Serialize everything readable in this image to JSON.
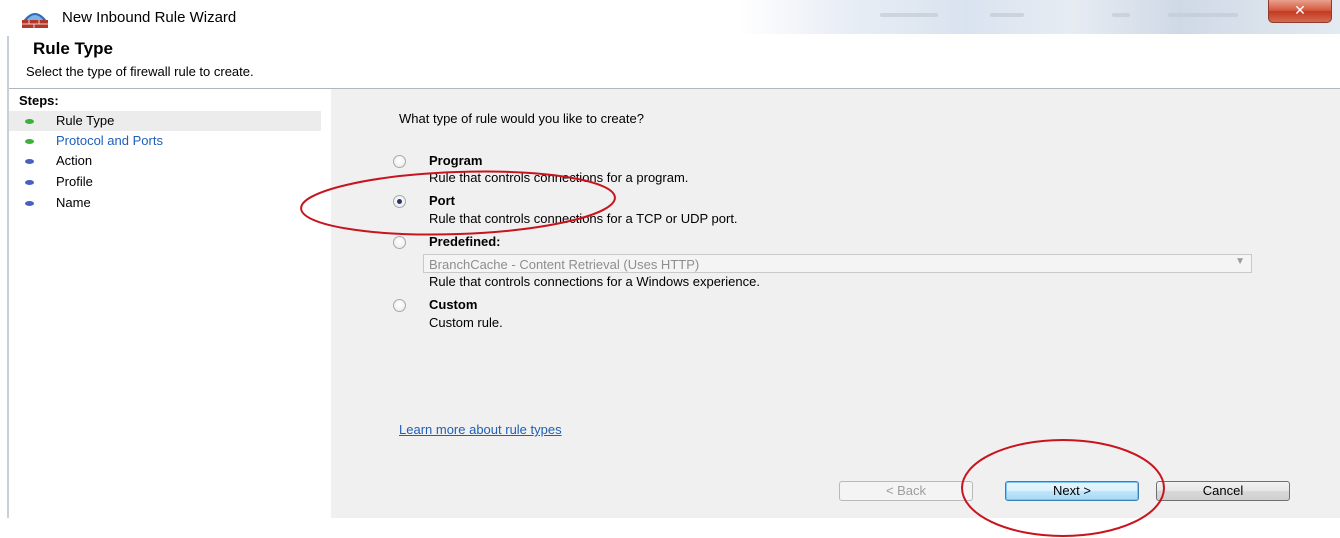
{
  "window": {
    "title": "New Inbound Rule Wizard",
    "close_glyph": "✕",
    "icon": "firewall-wizard-icon"
  },
  "header": {
    "title": "Rule Type",
    "subtitle": "Select the type of firewall rule to create."
  },
  "steps": {
    "heading": "Steps:",
    "items": [
      {
        "label": "Rule Type",
        "dot_color": "#3fae3a",
        "state": "current"
      },
      {
        "label": "Protocol and Ports",
        "dot_color": "#3fae3a",
        "state": "link"
      },
      {
        "label": "Action",
        "dot_color": "#4a5fc4",
        "state": "pending"
      },
      {
        "label": "Profile",
        "dot_color": "#4a5fc4",
        "state": "pending"
      },
      {
        "label": "Name",
        "dot_color": "#4a5fc4",
        "state": "pending"
      }
    ]
  },
  "main": {
    "question": "What type of rule would you like to create?",
    "options": [
      {
        "label": "Program",
        "description": "Rule that controls connections for a program.",
        "checked": false
      },
      {
        "label": "Port",
        "description": "Rule that controls connections for a TCP or UDP port.",
        "checked": true
      },
      {
        "label": "Predefined:",
        "description": "Rule that controls connections for a Windows experience.",
        "checked": false
      },
      {
        "label": "Custom",
        "description": "Custom rule.",
        "checked": false
      }
    ],
    "predefined_select": {
      "value": "BranchCache - Content Retrieval (Uses HTTP)",
      "arrow": "▼"
    },
    "learn_more_link": "Learn more about rule types"
  },
  "buttons": {
    "back": "< Back",
    "next": "Next >",
    "cancel": "Cancel"
  },
  "colors": {
    "annotation_ellipse": "#c8141e",
    "link": "#1e5fb8"
  }
}
